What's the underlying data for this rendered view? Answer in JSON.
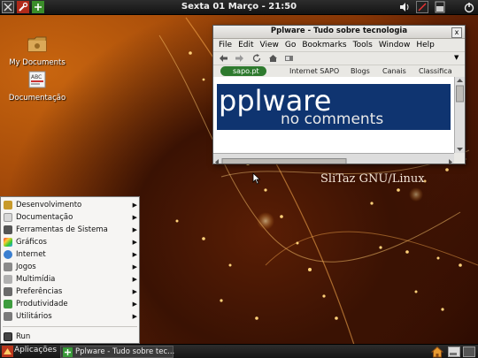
{
  "top_panel": {
    "clock": "Sexta 01 Março - 21:50",
    "left_icons": [
      "x-terminal-icon",
      "wrench-tools-icon",
      "network-arrows-icon"
    ],
    "right_icons": [
      "volume-icon",
      "network-status-icon",
      "battery-icon",
      "power-icon"
    ]
  },
  "desktop": {
    "icons": [
      {
        "label": "My Documents",
        "icon": "folder-icon"
      },
      {
        "label": "Documentação",
        "icon": "abc-document-icon"
      }
    ],
    "watermark": "SliTaz GNU/Linux"
  },
  "browser": {
    "title": "Pplware - Tudo sobre tecnologia",
    "close_label": "x",
    "menu": [
      "File",
      "Edit",
      "View",
      "Go",
      "Bookmarks",
      "Tools",
      "Window",
      "Help"
    ],
    "bookmarks": {
      "sapo": "sapo.pt",
      "items": [
        "Internet SAPO",
        "Blogs",
        "Canais",
        "Classifica"
      ]
    },
    "banner": {
      "logo": "pplware",
      "subtitle": "no comments"
    }
  },
  "app_menu": {
    "items": [
      {
        "label": "Desenvolvimento",
        "icon": "development-icon",
        "submenu": true
      },
      {
        "label": "Documentação",
        "icon": "documentation-icon",
        "submenu": true
      },
      {
        "label": "Ferramentas de Sistema",
        "icon": "system-tools-icon",
        "submenu": true
      },
      {
        "label": "Gráficos",
        "icon": "graphics-icon",
        "submenu": true
      },
      {
        "label": "Internet",
        "icon": "internet-globe-icon",
        "submenu": true
      },
      {
        "label": "Jogos",
        "icon": "games-icon",
        "submenu": true
      },
      {
        "label": "Multimídia",
        "icon": "multimedia-icon",
        "submenu": true
      },
      {
        "label": "Preferências",
        "icon": "preferences-icon",
        "submenu": true
      },
      {
        "label": "Produtividade",
        "icon": "productivity-icon",
        "submenu": true
      },
      {
        "label": "Utilitários",
        "icon": "utilities-icon",
        "submenu": true
      }
    ],
    "run": {
      "label": "Run",
      "icon": "run-icon"
    }
  },
  "bottom_panel": {
    "apps_label": "Aplicações",
    "task_label": "Pplware - Tudo sobre tec..."
  },
  "colors": {
    "menu_icon_colors": [
      "#c89a2a",
      "#d8d8d8",
      "#555555",
      "#4aa83a",
      "#3b7fd0",
      "#8a8a8a",
      "#b0b0b0",
      "#6a6a6a",
      "#3e9c3e",
      "#7a7a7a"
    ]
  }
}
